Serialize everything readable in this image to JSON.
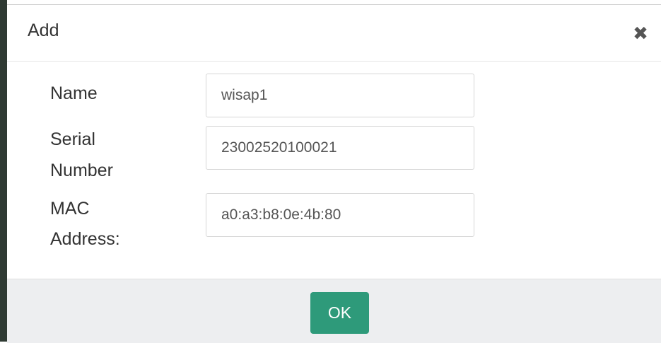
{
  "dialog": {
    "title": "Add",
    "close_icon": "close-icon",
    "close_glyph": "✖"
  },
  "form": {
    "name": {
      "label": "Name",
      "value": "wisap1"
    },
    "serial_number": {
      "label_line1": "Serial",
      "label_line2": "Number",
      "value": "23002520100021"
    },
    "mac_address": {
      "label_line1": "MAC",
      "label_line2": "Address:",
      "value": "a0:a3:b8:0e:4b:80"
    }
  },
  "footer": {
    "ok_label": "OK"
  },
  "colors": {
    "ok_button": "#2e9a7a",
    "footer_background": "#edeef0"
  }
}
